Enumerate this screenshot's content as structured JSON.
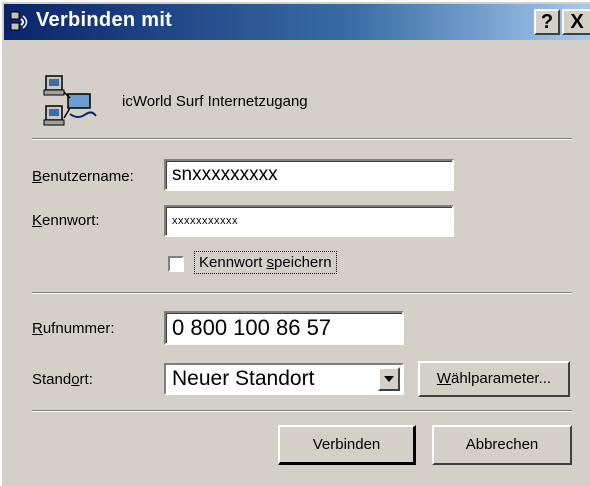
{
  "window": {
    "title": "Verbinden mit",
    "help_label": "?",
    "close_label": "X"
  },
  "connection": {
    "name": "icWorld Surf Internetzugang"
  },
  "fields": {
    "username_label": "Benutzername:",
    "username_value": "snxxxxxxxxx",
    "password_label": "Kennwort:",
    "password_value": "xxxxxxxxxxx",
    "save_password_label": "Kennwort speichern",
    "save_password_checked": false,
    "phone_label": "Rufnummer:",
    "phone_value": "0 800 100 86 57",
    "location_label": "Standort:",
    "location_value": "Neuer Standort"
  },
  "buttons": {
    "dial_params": "Wählparameter...",
    "connect": "Verbinden",
    "cancel": "Abbrechen"
  }
}
